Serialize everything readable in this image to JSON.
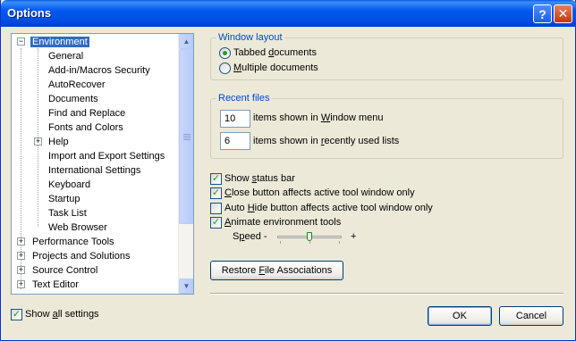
{
  "window": {
    "title": "Options",
    "help_glyph": "?",
    "close_glyph": "✕"
  },
  "tree": {
    "items": [
      {
        "label": "Environment",
        "expander": "−",
        "selected": true
      },
      {
        "label": "General"
      },
      {
        "label": "Add-in/Macros Security"
      },
      {
        "label": "AutoRecover"
      },
      {
        "label": "Documents"
      },
      {
        "label": "Find and Replace"
      },
      {
        "label": "Fonts and Colors"
      },
      {
        "label": "Help",
        "expander": "+"
      },
      {
        "label": "Import and Export Settings"
      },
      {
        "label": "International Settings"
      },
      {
        "label": "Keyboard"
      },
      {
        "label": "Startup"
      },
      {
        "label": "Task List"
      },
      {
        "label": "Web Browser"
      },
      {
        "label": "Performance Tools",
        "expander": "+"
      },
      {
        "label": "Projects and Solutions",
        "expander": "+"
      },
      {
        "label": "Source Control",
        "expander": "+"
      },
      {
        "label": "Text Editor",
        "expander": "+"
      }
    ]
  },
  "show_all": {
    "label_pre": "Show ",
    "label_u": "a",
    "label_post": "ll settings",
    "checked": true
  },
  "window_layout": {
    "title": "Window layout",
    "options": [
      {
        "pre": "Tabbed ",
        "u": "d",
        "post": "ocuments",
        "checked": true
      },
      {
        "pre": "",
        "u": "M",
        "post": "ultiple documents",
        "checked": false
      }
    ]
  },
  "recent_files": {
    "title": "Recent files",
    "window_menu_count": "10",
    "window_menu_pre": "items shown in ",
    "window_menu_u": "W",
    "window_menu_post": "indow menu",
    "recent_count": "6",
    "recent_pre": "items shown in ",
    "recent_u": "r",
    "recent_post": "ecently used lists"
  },
  "options": {
    "status_bar": {
      "pre": "Show ",
      "u": "s",
      "post": "tatus bar",
      "checked": true
    },
    "close_button": {
      "pre": "",
      "u": "C",
      "post": "lose button affects active tool window only",
      "checked": true
    },
    "auto_hide": {
      "pre": "Auto ",
      "u": "H",
      "post": "ide button affects active tool window only",
      "checked": false
    },
    "animate": {
      "pre": "",
      "u": "A",
      "post": "nimate environment tools",
      "checked": true
    },
    "speed_pre": "S",
    "speed_u": "p",
    "speed_post": "eed -",
    "speed_plus": "+",
    "speed_level": 0.5
  },
  "restore_button": {
    "pre": "Restore ",
    "u": "F",
    "post": "ile Associations"
  },
  "ok_label": "OK",
  "cancel_label": "Cancel",
  "colors": {
    "titlebar": "#0058ee",
    "group_title": "#0046d5",
    "selection": "#316ac5",
    "check_mark": "#21a121",
    "dialog_bg": "#ece9d8"
  }
}
